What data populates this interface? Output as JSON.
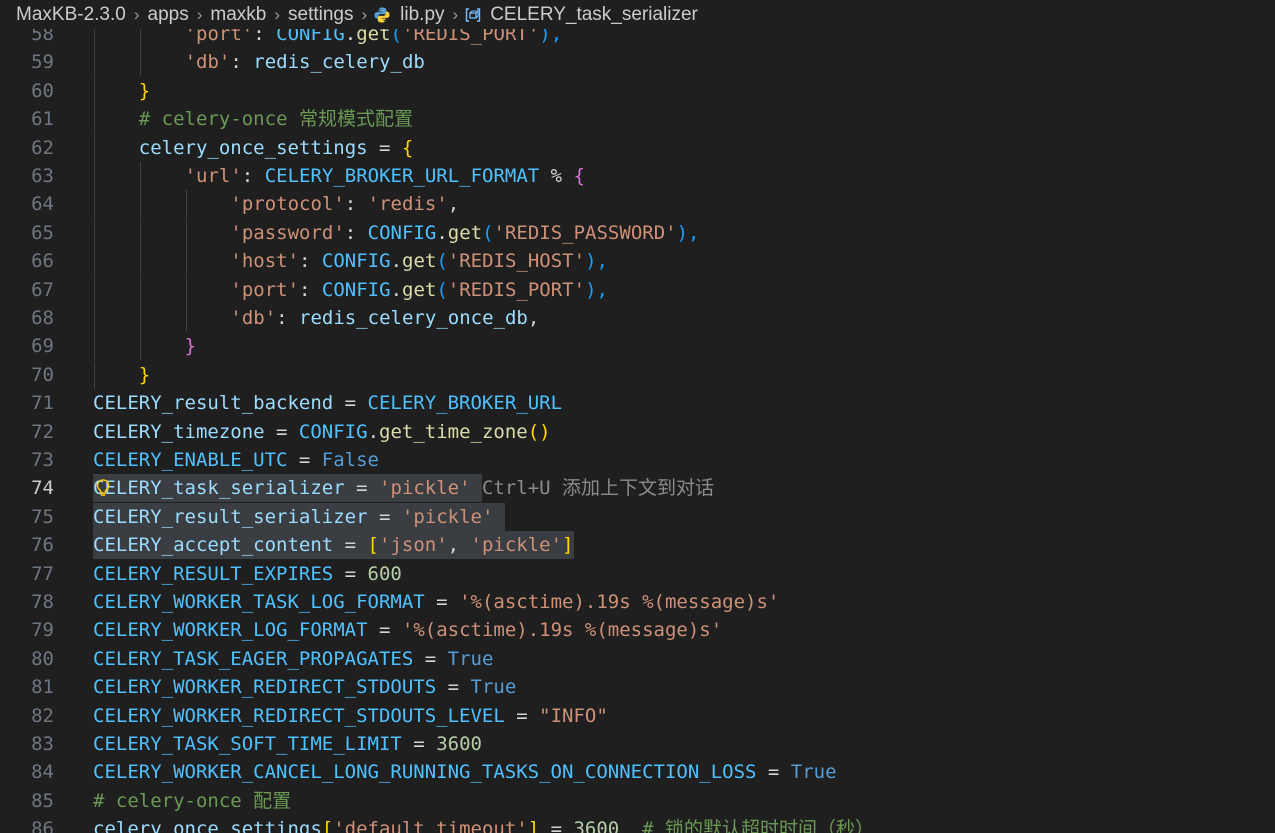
{
  "breadcrumb": {
    "project": "MaxKB-2.3.0",
    "dir1": "apps",
    "dir2": "maxkb",
    "dir3": "settings",
    "file": "lib.py",
    "symbol": "CELERY_task_serializer",
    "file_icon": "python-icon",
    "symbol_icon": "variable-symbol-icon"
  },
  "inline_hint": {
    "shortcut": "Ctrl+U",
    "text": "添加上下文到对话"
  },
  "colors": {
    "background": "#1f1f1f",
    "variable": "#9cdcfe",
    "constant": "#4fc1ff",
    "string": "#ce9178",
    "function": "#dcdcaa",
    "number": "#b5cea8",
    "keyword_bool": "#569cd6",
    "comment": "#6a9955"
  },
  "lines": [
    {
      "n": "58",
      "t": [
        "'port'",
        ": ",
        "CONFIG",
        ".",
        "get",
        "(",
        "'REDIS_PORT'",
        "),"
      ]
    },
    {
      "n": "59",
      "t": [
        "'db'",
        ": ",
        "redis_celery_db"
      ]
    },
    {
      "n": "60",
      "t": [
        "}"
      ]
    },
    {
      "n": "61",
      "t": [
        "# celery-once 常规模式配置"
      ]
    },
    {
      "n": "62",
      "t": [
        "celery_once_settings",
        " = ",
        "{"
      ]
    },
    {
      "n": "63",
      "t": [
        "'url'",
        ": ",
        "CELERY_BROKER_URL_FORMAT",
        " % ",
        "{"
      ]
    },
    {
      "n": "64",
      "t": [
        "'protocol'",
        ": ",
        "'redis'",
        ","
      ]
    },
    {
      "n": "65",
      "t": [
        "'password'",
        ": ",
        "CONFIG",
        ".",
        "get",
        "(",
        "'REDIS_PASSWORD'",
        "),"
      ]
    },
    {
      "n": "66",
      "t": [
        "'host'",
        ": ",
        "CONFIG",
        ".",
        "get",
        "(",
        "'REDIS_HOST'",
        "),"
      ]
    },
    {
      "n": "67",
      "t": [
        "'port'",
        ": ",
        "CONFIG",
        ".",
        "get",
        "(",
        "'REDIS_PORT'",
        "),"
      ]
    },
    {
      "n": "68",
      "t": [
        "'db'",
        ": ",
        "redis_celery_once_db",
        ","
      ]
    },
    {
      "n": "69",
      "t": [
        "}"
      ]
    },
    {
      "n": "70",
      "t": [
        "}"
      ]
    },
    {
      "n": "71",
      "t": [
        "CELERY_result_backend",
        " = ",
        "CELERY_BROKER_URL"
      ]
    },
    {
      "n": "72",
      "t": [
        "CELERY_timezone",
        " = ",
        "CONFIG",
        ".",
        "get_time_zone",
        "()"
      ]
    },
    {
      "n": "73",
      "t": [
        "CELERY_ENABLE_UTC",
        " = ",
        "False"
      ]
    },
    {
      "n": "74",
      "t": [
        "CELERY_task_serializer",
        " = ",
        "'pickle'"
      ]
    },
    {
      "n": "75",
      "t": [
        "CELERY_result_serializer",
        " = ",
        "'pickle'"
      ]
    },
    {
      "n": "76",
      "t": [
        "CELERY_accept_content",
        " = ",
        "[",
        "'json'",
        ", ",
        "'pickle'",
        "]"
      ]
    },
    {
      "n": "77",
      "t": [
        "CELERY_RESULT_EXPIRES",
        " = ",
        "600"
      ]
    },
    {
      "n": "78",
      "t": [
        "CELERY_WORKER_TASK_LOG_FORMAT",
        " = ",
        "'%(asctime).19s %(message)s'"
      ]
    },
    {
      "n": "79",
      "t": [
        "CELERY_WORKER_LOG_FORMAT",
        " = ",
        "'%(asctime).19s %(message)s'"
      ]
    },
    {
      "n": "80",
      "t": [
        "CELERY_TASK_EAGER_PROPAGATES",
        " = ",
        "True"
      ]
    },
    {
      "n": "81",
      "t": [
        "CELERY_WORKER_REDIRECT_STDOUTS",
        " = ",
        "True"
      ]
    },
    {
      "n": "82",
      "t": [
        "CELERY_WORKER_REDIRECT_STDOUTS_LEVEL",
        " = ",
        "\"INFO\""
      ]
    },
    {
      "n": "83",
      "t": [
        "CELERY_TASK_SOFT_TIME_LIMIT",
        " = ",
        "3600"
      ]
    },
    {
      "n": "84",
      "t": [
        "CELERY_WORKER_CANCEL_LONG_RUNNING_TASKS_ON_CONNECTION_LOSS",
        " = ",
        "True"
      ]
    },
    {
      "n": "85",
      "t": [
        "# celery-once 配置"
      ]
    },
    {
      "n": "86",
      "t": [
        "celery_once_settings",
        "[",
        "'default_timeout'",
        "]",
        " = ",
        "3600",
        "  ",
        "# 锁的默认超时时间（秒）"
      ]
    }
  ]
}
